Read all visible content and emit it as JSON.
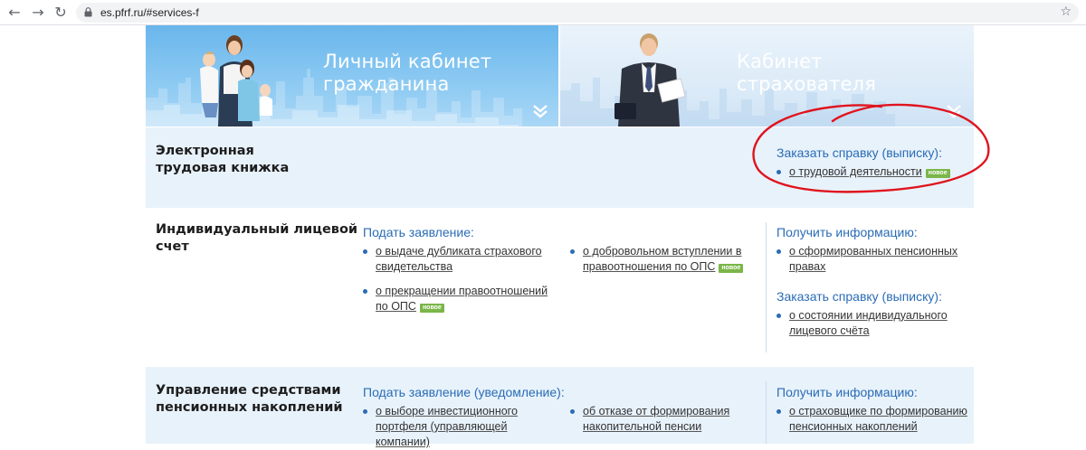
{
  "browser": {
    "url": "es.pfrf.ru/#services-f"
  },
  "banners": {
    "citizen": {
      "title_line1": "Личный кабинет",
      "title_line2": "гражданина"
    },
    "insurer": {
      "title_line1": "Кабинет",
      "title_line2": "страхователя"
    }
  },
  "badge_label": "новое",
  "sections": {
    "etk": {
      "title_line1": "Электронная",
      "title_line2": "трудовая книжка",
      "right": {
        "heading": "Заказать справку (выписку):",
        "items": [
          {
            "label": "о трудовой деятельности"
          }
        ]
      }
    },
    "ils": {
      "title_line1": "Индивидуальный лицевой",
      "title_line2": "счет",
      "apply": {
        "heading": "Подать заявление:",
        "items": [
          {
            "line1": "о выдаче дубликата страхового",
            "line2": "свидетельства"
          },
          {
            "line1": "о прекращении правоотношений",
            "line2": "по ОПС"
          },
          {
            "line1": "о добровольном вступлении в",
            "line2": "правоотношения по ОПС"
          }
        ]
      },
      "info": {
        "heading": "Получить информацию:",
        "items": [
          {
            "line1": "о сформированных пенсионных",
            "line2": "правах"
          }
        ]
      },
      "order": {
        "heading": "Заказать справку (выписку):",
        "items": [
          {
            "line1": "о состоянии индивидуального",
            "line2": "лицевого счёта"
          }
        ]
      }
    },
    "savings": {
      "title_line1": "Управление средствами",
      "title_line2": "пенсионных накоплений",
      "apply": {
        "heading": "Подать заявление (уведомление):",
        "items": [
          {
            "line1": "о выборе инвестиционного",
            "line2": "портфеля (управляющей",
            "line3": "компании)"
          },
          {
            "line1": "об отказе от формирования",
            "line2": "накопительной пенсии"
          }
        ]
      },
      "info": {
        "heading": "Получить информацию:",
        "items": [
          {
            "line1": "о страховщике по формированию",
            "line2": "пенсионных накоплений"
          }
        ]
      }
    }
  },
  "colors": {
    "link_blue": "#2a6cb5",
    "badge_green": "#7ab648",
    "section_bg": "#e8f2fb",
    "annotation_red": "#e0141e"
  },
  "icons": {
    "back": "arrow-left-icon",
    "forward": "arrow-right-icon",
    "reload": "reload-icon",
    "lock": "lock-icon",
    "bookmark": "star-icon",
    "expand": "double-chevron-down-icon"
  }
}
